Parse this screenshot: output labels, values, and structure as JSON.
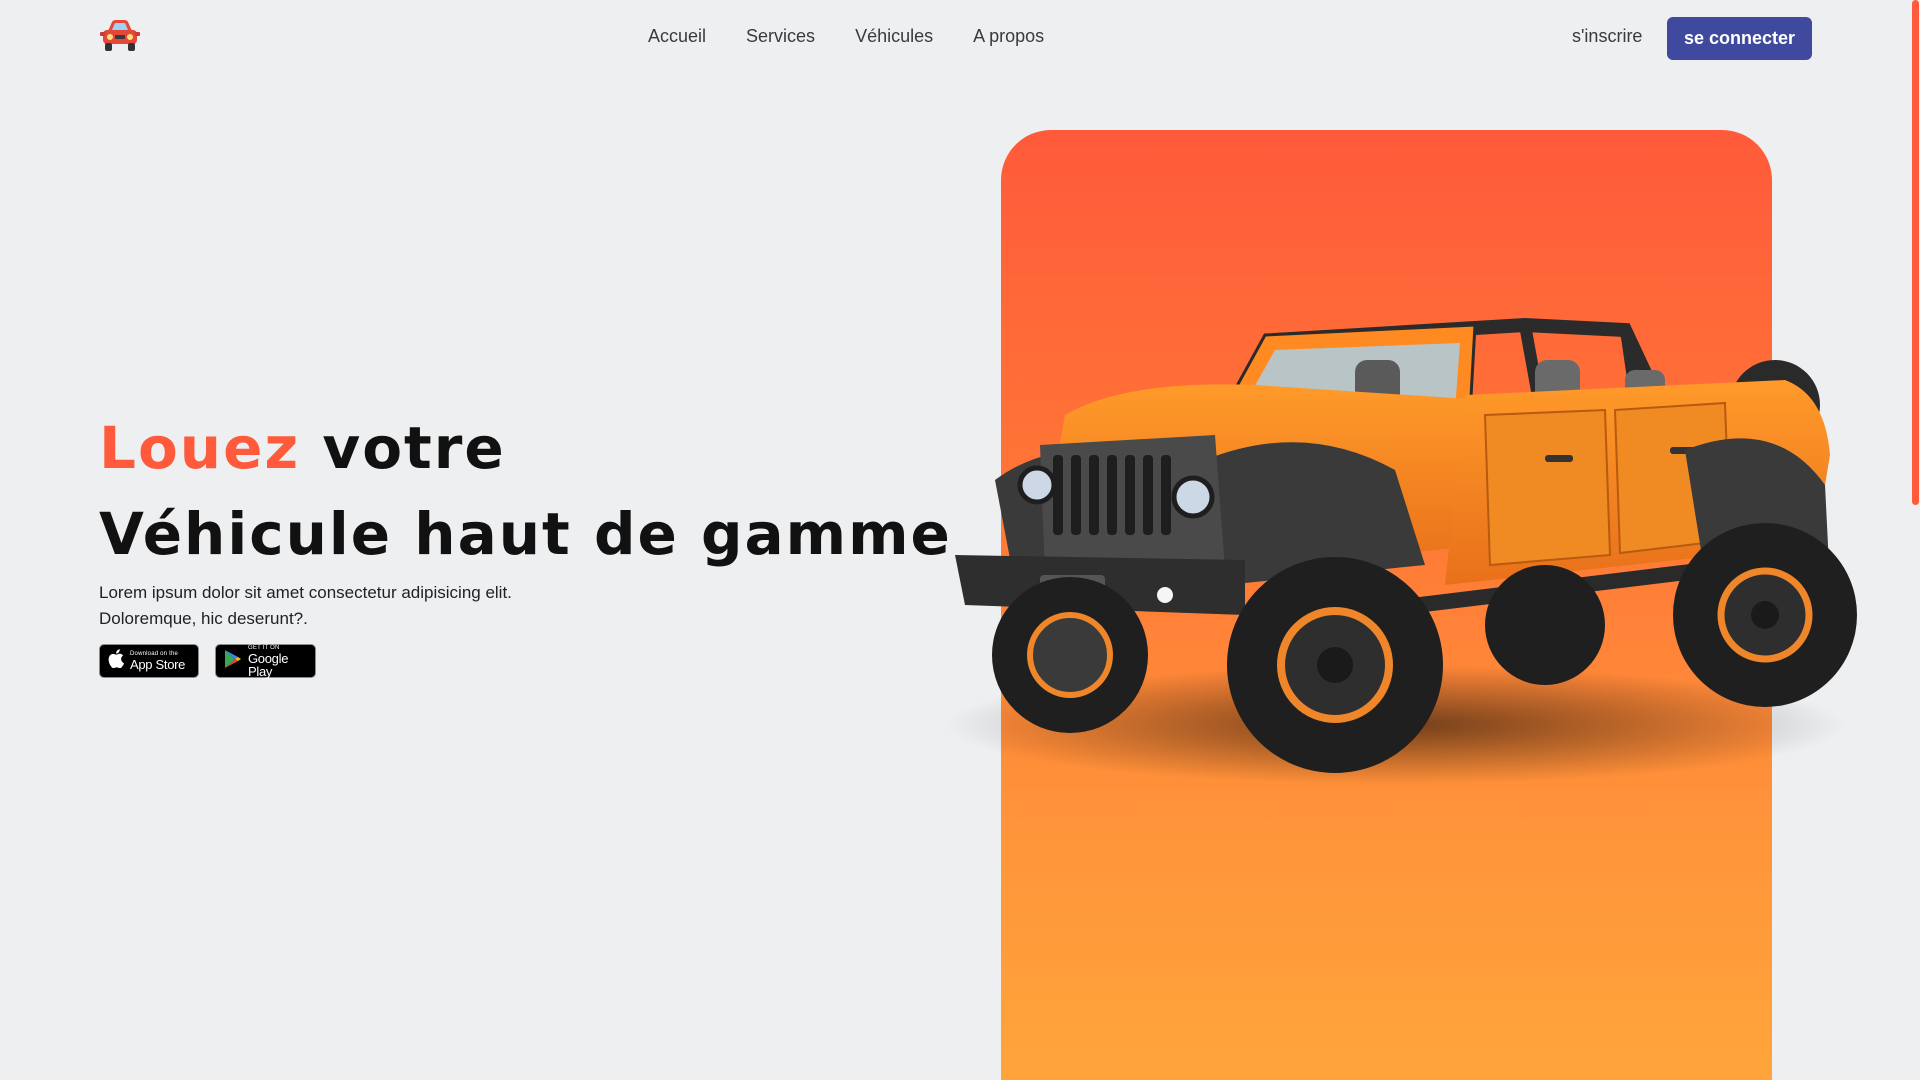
{
  "header": {
    "logo_icon": "car-icon",
    "nav": [
      {
        "label": "Accueil"
      },
      {
        "label": "Services"
      },
      {
        "label": "Véhicules"
      },
      {
        "label": "A propos"
      }
    ],
    "signup_label": "s'inscrire",
    "login_label": "se connecter"
  },
  "hero": {
    "title_accent": "Louez",
    "title_rest": " votre",
    "title_line2": "Véhicule haut de gamme",
    "description_line1": "Lorem ipsum dolor sit amet consectetur adipisicing elit.",
    "description_line2": "Doloremque, hic deserunt?.",
    "app_store": {
      "small": "Download on the",
      "big": "App Store",
      "icon": "apple-icon"
    },
    "google_play": {
      "small": "GET IT ON",
      "big": "Google Play",
      "icon": "play-icon"
    },
    "image": "orange-jeep"
  },
  "colors": {
    "accent": "#ff5a3c",
    "primary_button": "#3f4a9e",
    "background": "#eeeff1",
    "panel_top": "#ff5a3b",
    "panel_bottom": "#ffa53a"
  }
}
